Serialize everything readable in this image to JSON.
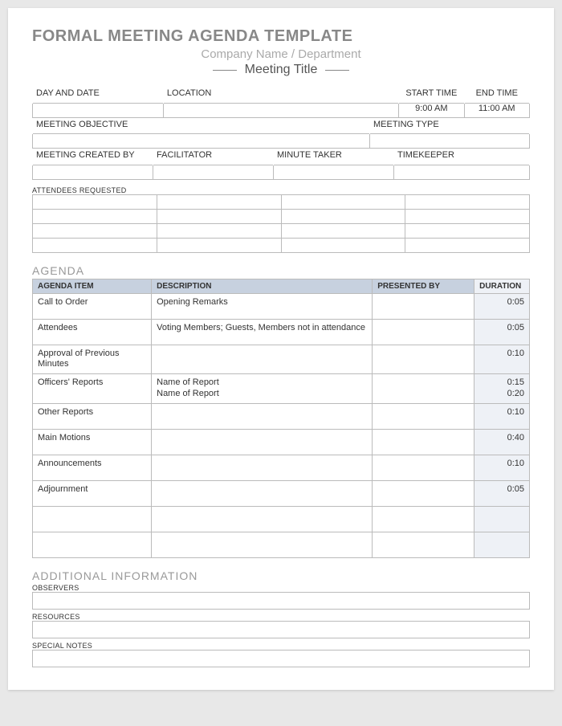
{
  "title": "FORMAL MEETING AGENDA TEMPLATE",
  "subtitle": "Company Name / Department",
  "meetingTitle": "Meeting Title",
  "fields": {
    "dayDate": {
      "label": "DAY AND DATE",
      "value": ""
    },
    "location": {
      "label": "LOCATION",
      "value": ""
    },
    "startTime": {
      "label": "START TIME",
      "value": "9:00 AM"
    },
    "endTime": {
      "label": "END TIME",
      "value": "11:00 AM"
    },
    "objective": {
      "label": "MEETING OBJECTIVE",
      "value": ""
    },
    "type": {
      "label": "MEETING TYPE",
      "value": ""
    },
    "createdBy": {
      "label": "MEETING CREATED BY",
      "value": ""
    },
    "facilitator": {
      "label": "FACILITATOR",
      "value": ""
    },
    "minuteTaker": {
      "label": "MINUTE TAKER",
      "value": ""
    },
    "timekeeper": {
      "label": "TIMEKEEPER",
      "value": ""
    },
    "attendeesReq": {
      "label": "ATTENDEES REQUESTED"
    }
  },
  "agenda": {
    "heading": "AGENDA",
    "headers": {
      "item": "AGENDA ITEM",
      "desc": "DESCRIPTION",
      "pres": "PRESENTED BY",
      "dur": "DURATION"
    },
    "rows": [
      {
        "item": "Call to Order",
        "desc": "Opening Remarks",
        "pres": "",
        "dur": "0:05"
      },
      {
        "item": "Attendees",
        "desc": "Voting Members; Guests, Members not in attendance",
        "pres": "",
        "dur": "0:05"
      },
      {
        "item": "Approval of Previous Minutes",
        "desc": "",
        "pres": "",
        "dur": "0:10"
      },
      {
        "item": "Officers' Reports",
        "desc": "Name of Report\nName of Report",
        "pres": "",
        "dur": "0:15\n0:20"
      },
      {
        "item": "Other Reports",
        "desc": "",
        "pres": "",
        "dur": "0:10"
      },
      {
        "item": "Main Motions",
        "desc": "",
        "pres": "",
        "dur": "0:40"
      },
      {
        "item": "Announcements",
        "desc": "",
        "pres": "",
        "dur": "0:10"
      },
      {
        "item": "Adjournment",
        "desc": "",
        "pres": "",
        "dur": "0:05"
      },
      {
        "item": "",
        "desc": "",
        "pres": "",
        "dur": ""
      },
      {
        "item": "",
        "desc": "",
        "pres": "",
        "dur": ""
      }
    ]
  },
  "additional": {
    "heading": "ADDITIONAL INFORMATION",
    "observers": {
      "label": "OBSERVERS",
      "value": ""
    },
    "resources": {
      "label": "RESOURCES",
      "value": ""
    },
    "specialNotes": {
      "label": "SPECIAL NOTES",
      "value": ""
    }
  }
}
